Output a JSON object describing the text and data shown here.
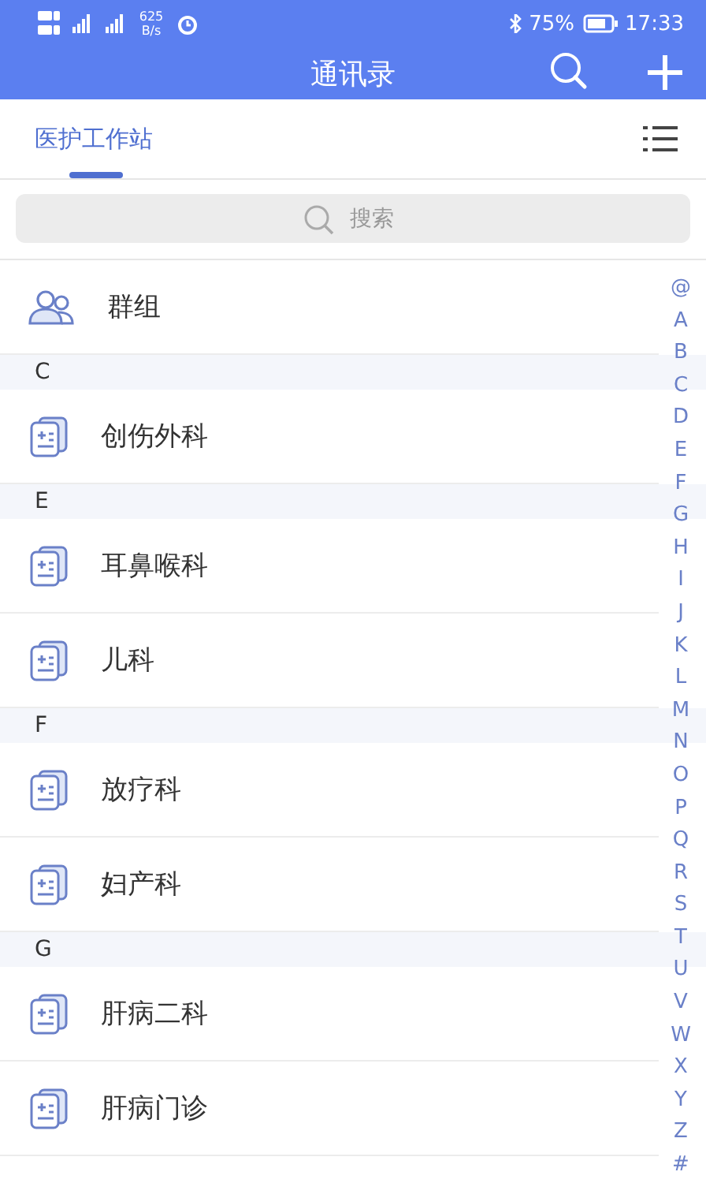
{
  "status_bar": {
    "net_speed": "625 B/s",
    "battery": "75%",
    "time": "17:33"
  },
  "header": {
    "title": "通讯录"
  },
  "tabs": [
    {
      "label": "医护工作站",
      "selected": true
    }
  ],
  "search": {
    "placeholder": "搜索"
  },
  "list": [
    {
      "kind": "group",
      "label": "群组"
    },
    {
      "kind": "section",
      "label": "C"
    },
    {
      "kind": "dept",
      "label": "创伤外科"
    },
    {
      "kind": "section",
      "label": "E"
    },
    {
      "kind": "dept",
      "label": "耳鼻喉科"
    },
    {
      "kind": "dept",
      "label": "儿科"
    },
    {
      "kind": "section",
      "label": "F"
    },
    {
      "kind": "dept",
      "label": "放疗科"
    },
    {
      "kind": "dept",
      "label": "妇产科"
    },
    {
      "kind": "section",
      "label": "G"
    },
    {
      "kind": "dept",
      "label": "肝病二科"
    },
    {
      "kind": "dept",
      "label": "肝病门诊"
    }
  ],
  "index": [
    "@",
    "A",
    "B",
    "C",
    "D",
    "E",
    "F",
    "G",
    "H",
    "I",
    "J",
    "K",
    "L",
    "M",
    "N",
    "O",
    "P",
    "Q",
    "R",
    "S",
    "T",
    "U",
    "V",
    "W",
    "X",
    "Y",
    "Z",
    "#"
  ]
}
